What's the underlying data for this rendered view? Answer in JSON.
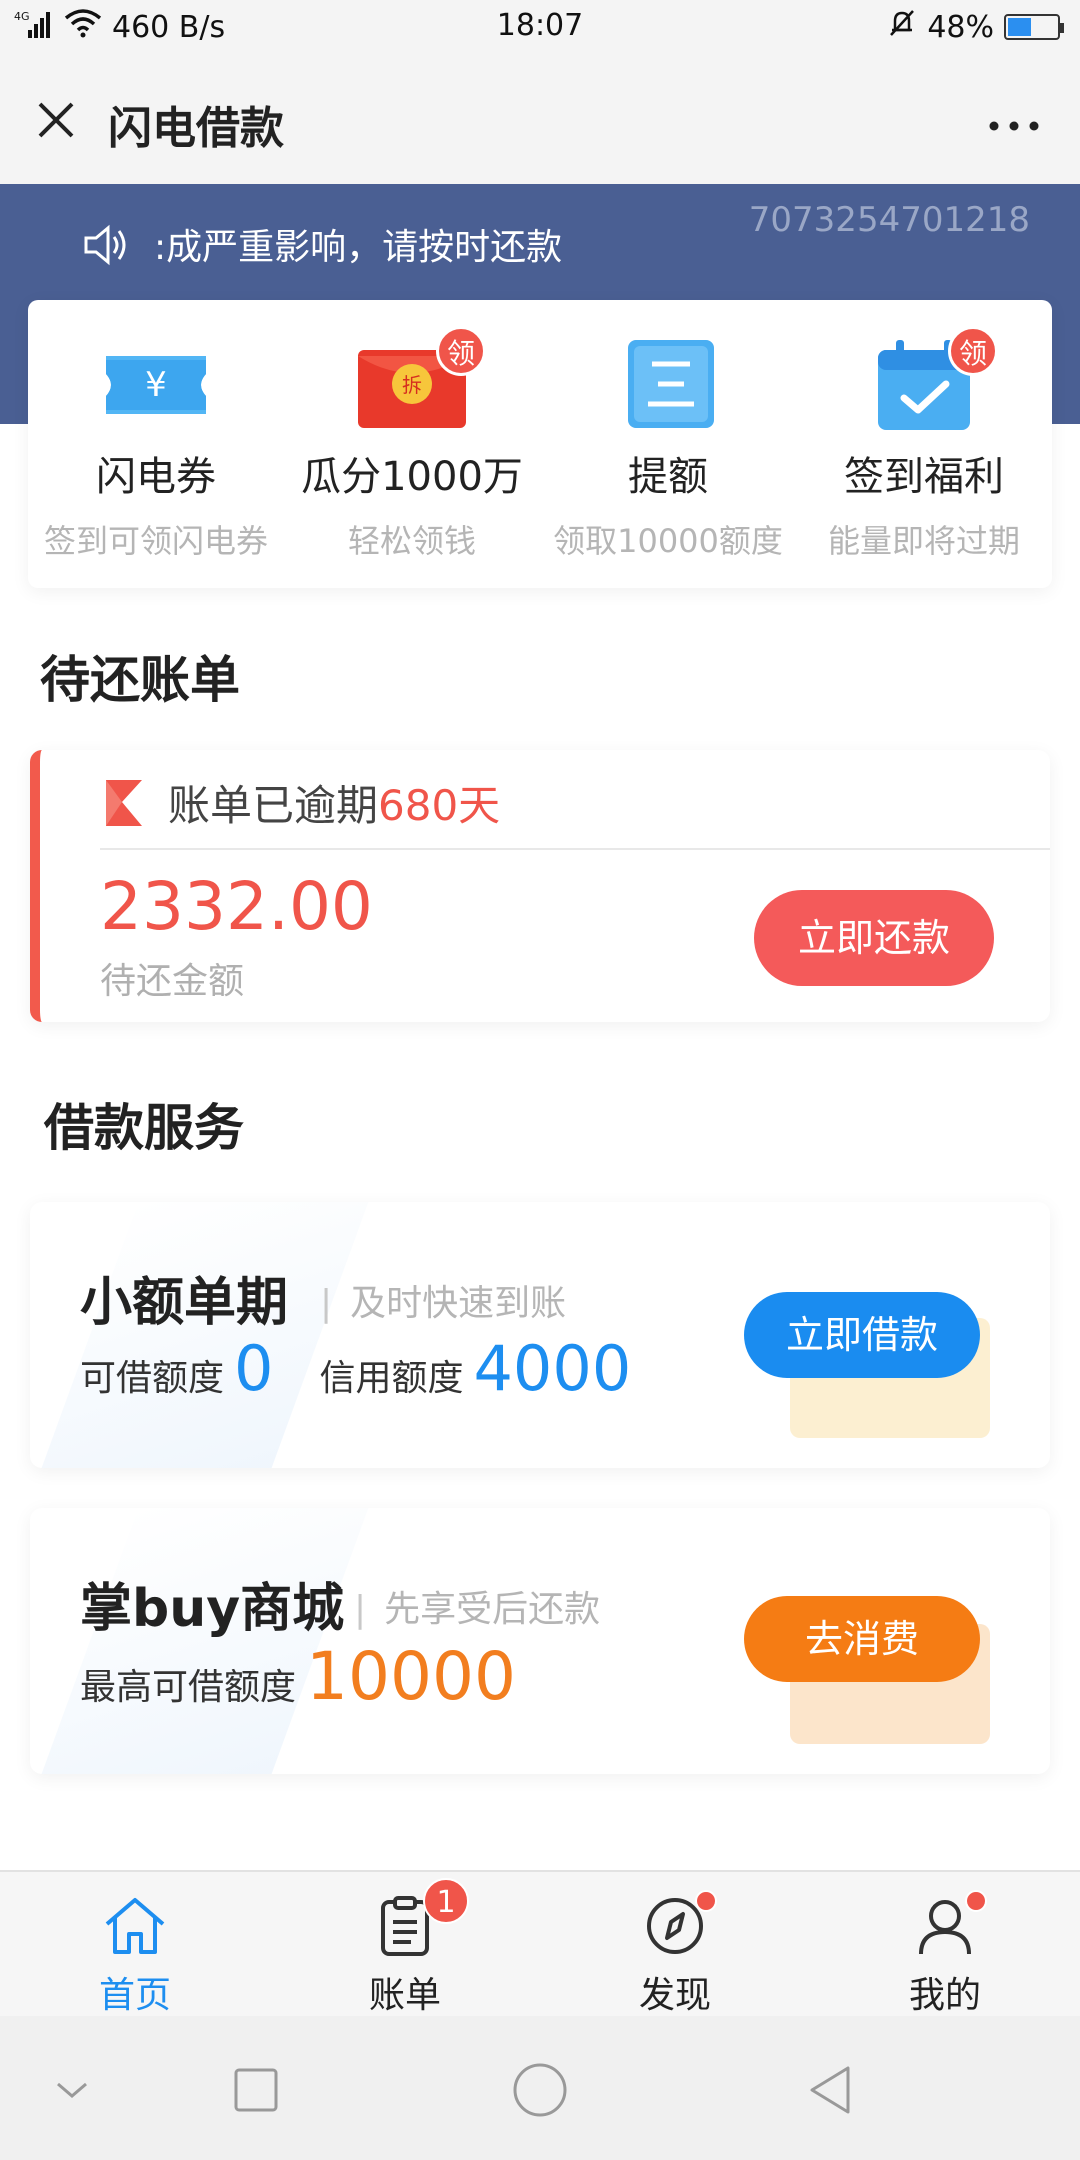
{
  "status_bar": {
    "network": "4G",
    "speed": "460 B/s",
    "time": "18:07",
    "battery": "48%",
    "battery_level": 0.48
  },
  "header": {
    "title": "闪电借款",
    "close_icon": "close-icon",
    "more_icon": "more-icon"
  },
  "notice": {
    "text": ":成严重影响，请按时还款",
    "account_id": "7073254701218"
  },
  "features": [
    {
      "name": "闪电券",
      "desc": "签到可领闪电券",
      "icon": "coupon-icon",
      "badge": ""
    },
    {
      "name": "瓜分1000万",
      "desc": "轻松领钱",
      "icon": "red-envelope-icon",
      "badge": "领"
    },
    {
      "name": "提额",
      "desc": "领取10000额度",
      "icon": "document-icon",
      "badge": ""
    },
    {
      "name": "签到福利",
      "desc": "能量即将过期",
      "icon": "calendar-check-icon",
      "badge": "领"
    }
  ],
  "red_envelope_text": "拆",
  "pending_bills": {
    "title": "待还账单",
    "status_prefix": "账单已逾期",
    "overdue_days": "680天",
    "amount": "2332.00",
    "amount_label": "待还金额",
    "repay_button": "立即还款"
  },
  "loan_services": {
    "title": "借款服务",
    "items": [
      {
        "name": "小额单期",
        "desc": "及时快速到账",
        "available_label": "可借额度",
        "available_value": "0",
        "credit_label": "信用额度",
        "credit_value": "4000",
        "button": "立即借款",
        "button_color": "#1a8cf0"
      },
      {
        "name": "掌buy商城",
        "desc": "先享受后还款",
        "max_label": "最高可借额度",
        "max_value": "10000",
        "button": "去消费",
        "button_color": "#f57c14"
      }
    ]
  },
  "tab_bar": {
    "items": [
      {
        "label": "首页",
        "icon": "home-icon",
        "active": true
      },
      {
        "label": "账单",
        "icon": "bill-icon",
        "badge": "1"
      },
      {
        "label": "发现",
        "icon": "compass-icon",
        "dot": true
      },
      {
        "label": "我的",
        "icon": "user-icon",
        "dot": true
      }
    ]
  },
  "colors": {
    "accent_blue": "#1d8ef0",
    "alert_red": "#f0554a",
    "banner_bg": "#4a5f93",
    "orange": "#f57c14"
  }
}
